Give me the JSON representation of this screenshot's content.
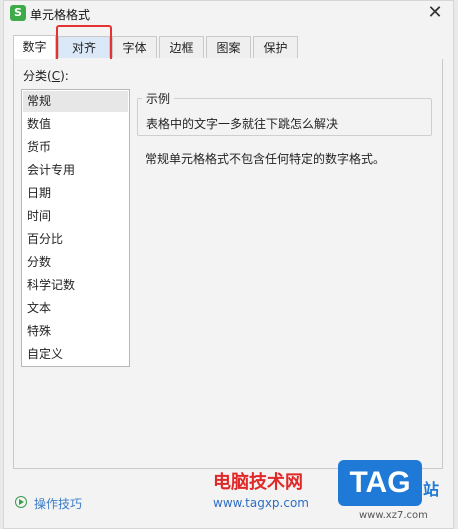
{
  "window": {
    "title": "单元格格式",
    "icon_letter": "S",
    "close_glyph": "✕"
  },
  "tabs": [
    {
      "label": "数字",
      "active": true
    },
    {
      "label": "对齐",
      "highlighted": true
    },
    {
      "label": "字体"
    },
    {
      "label": "边框"
    },
    {
      "label": "图案"
    },
    {
      "label": "保护"
    }
  ],
  "category": {
    "label_prefix": "分类(",
    "label_key": "C",
    "label_suffix": "):",
    "items": [
      "常规",
      "数值",
      "货币",
      "会计专用",
      "日期",
      "时间",
      "百分比",
      "分数",
      "科学记数",
      "文本",
      "特殊",
      "自定义"
    ],
    "selected_index": 0
  },
  "example": {
    "legend": "示例",
    "text": "表格中的文字一多就往下跳怎么解决"
  },
  "description": "常规单元格格式不包含任何特定的数字格式。",
  "footer": {
    "tips_label": "操作技巧"
  },
  "watermark": {
    "site_name": "电脑技术网",
    "url": "www.tagxp.com",
    "logo_text": "TAG",
    "suffix": "站",
    "small_url": "www.xz7.com"
  },
  "colors": {
    "highlight_border": "#e53333",
    "brand_green": "#3eab4a",
    "link_blue": "#3a7cc8"
  }
}
